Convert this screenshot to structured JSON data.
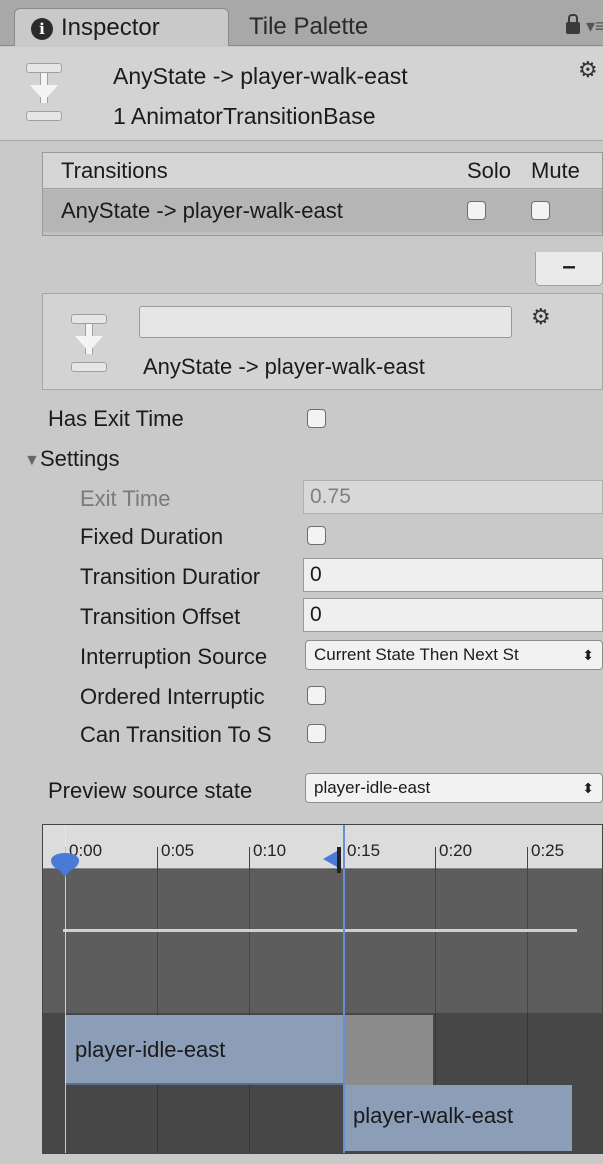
{
  "tabs": {
    "inspector": "Inspector",
    "tile_palette": "Tile Palette"
  },
  "header": {
    "title": "AnyState -> player-walk-east",
    "subtitle": "1 AnimatorTransitionBase"
  },
  "transitions": {
    "col_name": "Transitions",
    "col_solo": "Solo",
    "col_mute": "Mute",
    "rows": [
      {
        "label": "AnyState -> player-walk-east",
        "solo": false,
        "mute": false
      }
    ],
    "remove_label": "–"
  },
  "selected": {
    "name_value": "",
    "label": "AnyState -> player-walk-east"
  },
  "properties": {
    "has_exit_time": {
      "label": "Has Exit Time",
      "checked": false
    },
    "settings_label": "Settings",
    "exit_time": {
      "label": "Exit Time",
      "value": "0.75"
    },
    "fixed_duration": {
      "label": "Fixed Duration",
      "checked": false
    },
    "transition_duration": {
      "label": "Transition Duratior",
      "value": "0"
    },
    "transition_offset": {
      "label": "Transition Offset",
      "value": "0"
    },
    "interruption_source": {
      "label": "Interruption Source",
      "value": "Current State Then Next St"
    },
    "ordered_interruption": {
      "label": "Ordered Interruptic",
      "checked": false
    },
    "can_transition_to_self": {
      "label": "Can Transition To S",
      "checked": false
    }
  },
  "preview": {
    "label": "Preview source state",
    "value": "player-idle-east"
  },
  "timeline": {
    "ticks": [
      "0:00",
      "0:05",
      "0:10",
      "0:15",
      "0:20",
      "0:25"
    ],
    "source_state": "player-idle-east",
    "target_state": "player-walk-east"
  },
  "colors": {
    "accent": "#4a7ad8",
    "clip_bar": "#8b9db7"
  }
}
